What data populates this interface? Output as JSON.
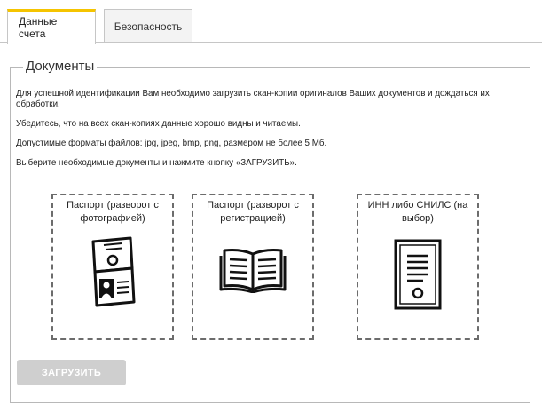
{
  "tabs": [
    {
      "label": "Данные счета",
      "active": true
    },
    {
      "label": "Безопасность",
      "active": false
    }
  ],
  "section": {
    "legend": "Документы",
    "paragraphs": [
      "Для успешной идентификации Вам необходимо загрузить скан-копии оригиналов Ваших документов и дождаться их обработки.",
      "Убедитесь, что на всех скан-копиях данные хорошо видны и читаемы.",
      "Допустимые форматы файлов: jpg, jpeg, bmp, png, размером не более 5 Мб.",
      "Выберите необходимые документы и нажмите кнопку «ЗАГРУЗИТЬ»."
    ]
  },
  "documents": [
    {
      "title": "Паспорт (разворот с фотографией)",
      "icon": "passport-photo-icon"
    },
    {
      "title": "Паспорт (разворот с регистрацией)",
      "icon": "open-book-icon"
    },
    {
      "title": "ИНН либо СНИЛС (на выбор)",
      "icon": "certificate-icon"
    }
  ],
  "upload_button": {
    "label": "ЗАГРУЗИТЬ",
    "disabled": true
  },
  "colors": {
    "accent": "#f5c400",
    "button_disabled": "#cfcfcf",
    "border": "#b8b8b8"
  }
}
